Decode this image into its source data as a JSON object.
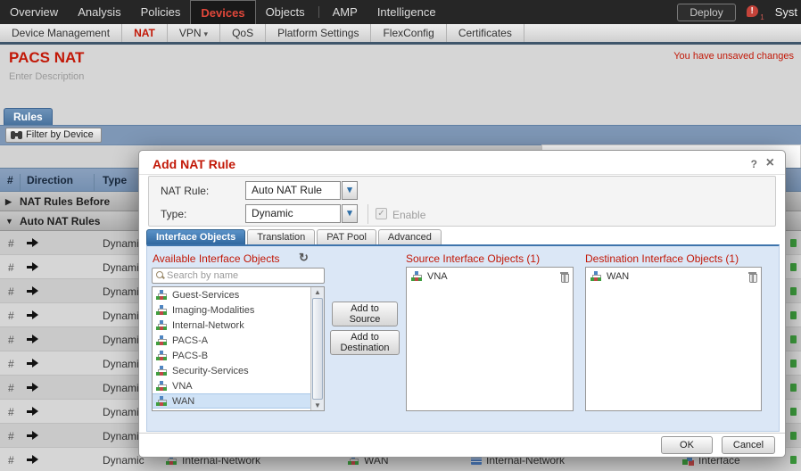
{
  "icons": {
    "refresh": "↻",
    "caret_down": "▾",
    "section_collapsed": "▶",
    "section_expanded": "▼",
    "scroll_up": "▲",
    "scroll_down": "▼",
    "help": "?",
    "close": "×",
    "check": "✓",
    "alert": "!"
  },
  "top_nav": {
    "items": [
      "Overview",
      "Analysis",
      "Policies",
      "Devices",
      "Objects",
      "AMP",
      "Intelligence"
    ],
    "active_item": "Devices",
    "deploy_label": "Deploy",
    "alert_count": "1",
    "system_label": "Syst"
  },
  "sub_nav": {
    "items": [
      "Device Management",
      "NAT",
      "VPN",
      "QoS",
      "Platform Settings",
      "FlexConfig",
      "Certificates"
    ],
    "active_item": "NAT"
  },
  "page": {
    "title": "PACS NAT",
    "description": "Enter Description",
    "unsaved_notice": "You have unsaved changes",
    "rules_tab": "Rules",
    "filter_button": "Filter by Device"
  },
  "table": {
    "headers": [
      "#",
      "Direction",
      "Type"
    ],
    "sections": [
      "NAT Rules Before",
      "Auto NAT Rules"
    ],
    "rows": {
      "number": "#",
      "type": "Dynamic"
    },
    "bottom_row": {
      "source_interface": "Internal-Network",
      "destination_interface": "WAN",
      "original_source": "Internal-Network",
      "translated": "Interface"
    }
  },
  "dialog": {
    "title": "Add NAT Rule",
    "fields": {
      "nat_rule_label": "NAT Rule:",
      "nat_rule_value": "Auto NAT Rule",
      "type_label": "Type:",
      "type_value": "Dynamic",
      "enable_label": "Enable"
    },
    "tabs": [
      "Interface Objects",
      "Translation",
      "PAT Pool",
      "Advanced"
    ],
    "available": {
      "label": "Available Interface Objects",
      "search_placeholder": "Search by name",
      "items": [
        "Guest-Services",
        "Imaging-Modalities",
        "Internal-Network",
        "PACS-A",
        "PACS-B",
        "Security-Services",
        "VNA",
        "WAN"
      ],
      "selected": "WAN"
    },
    "buttons": {
      "add_source": "Add to Source",
      "add_destination": "Add to Destination",
      "ok": "OK",
      "cancel": "Cancel"
    },
    "source": {
      "label": "Source Interface Objects (1)",
      "items": [
        "VNA"
      ]
    },
    "destination": {
      "label": "Destination Interface Objects (1)",
      "items": [
        "WAN"
      ]
    }
  },
  "colors": {
    "accent_red": "#c21807",
    "active_tab_blue": "#3068a0",
    "header_slate": "#7e97b6"
  }
}
